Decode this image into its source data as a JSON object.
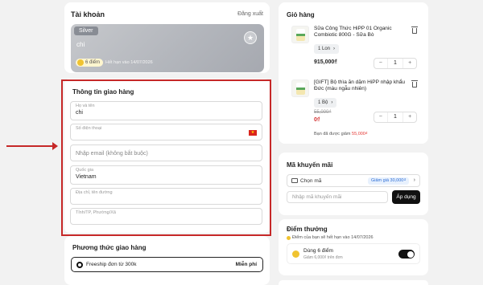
{
  "account": {
    "title": "Tài khoản",
    "logout": "Đăng xuất",
    "tier": "Silver",
    "name": "chi",
    "points_label": "6 điểm",
    "expiry": "Hết hạn vào 14/07/2026"
  },
  "shipping_info": {
    "title": "Thông tin giao hàng",
    "fullname_label": "Họ và tên",
    "fullname_value": "chi",
    "phone_label": "Số điện thoại",
    "phone_value": "",
    "email_placeholder": "Nhập email (không bắt buộc)",
    "country_label": "Quốc gia",
    "country_value": "Vietnam",
    "address_label": "Địa chỉ, tên đường",
    "province_label": "Tỉnh/TP, Phường/Xã"
  },
  "shipping_method": {
    "title": "Phương thức giao hàng",
    "option_label": "Freeship đơn từ 300k",
    "option_price": "Miễn phí"
  },
  "cart": {
    "title": "Giỏ hàng",
    "items": [
      {
        "name": "Sữa Công Thức HiPP 01 Organic Combiotic 800G - Sữa Bò",
        "variant": "1 Lon",
        "price": "915,000₫",
        "old_price": "",
        "quantity": "1"
      },
      {
        "name": "[GIFT] Bộ thìa ăn dặm HiPP nhập khẩu Đức (màu ngẫu nhiên)",
        "variant": "1 Bộ",
        "price": "0₫",
        "old_price": "55,000₫",
        "quantity": "1"
      }
    ],
    "discount_prefix": "Bạn đã được giảm",
    "discount_amount": "55,000₫"
  },
  "promo": {
    "title": "Mã khuyến mãi",
    "select_label": "Chọn mã",
    "badge": "Giảm giá 30,000₫",
    "input_placeholder": "Nhập mã khuyến mãi",
    "apply_label": "Áp dụng"
  },
  "points": {
    "title": "Điểm thưởng",
    "note": "Điểm của bạn sẽ hết hạn vào 14/07/2026",
    "use_title": "Dùng 6 điểm",
    "use_sub": "Giảm 6,000₫ trên đơn",
    "toggle_on": true
  },
  "colors": {
    "highlight_border": "#c62828",
    "accent_red": "#d32f2f",
    "button_dark": "#111111",
    "badge_blue": "#2f6fd6"
  }
}
